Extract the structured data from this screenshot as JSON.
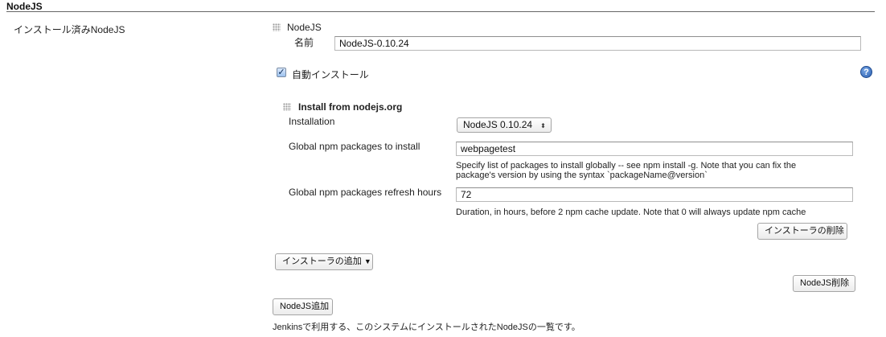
{
  "section": {
    "title": "NodeJS",
    "installations_label": "インストール済みNodeJS"
  },
  "installation": {
    "header": "NodeJS",
    "name_label": "名前",
    "name_value": "NodeJS-0.10.24",
    "auto_install_label": "自動インストール",
    "auto_install_checked": true,
    "help_icon": "help-icon"
  },
  "installer": {
    "header": "Install from nodejs.org",
    "installation_label": "Installation",
    "installation_value": "NodeJS 0.10.24",
    "npm_packages_label": "Global npm packages to install",
    "npm_packages_value": "webpagetest",
    "npm_packages_desc_line1": "Specify list of packages to install globally -- see npm install -g. Note that you can fix the",
    "npm_packages_desc_line2": "package's version by using the syntax `packageName@version`",
    "refresh_label": "Global npm packages refresh hours",
    "refresh_value": "72",
    "refresh_desc": "Duration, in hours, before 2 npm cache update. Note that 0 will always update npm cache",
    "delete_installer_label": "インストーラの削除"
  },
  "buttons": {
    "add_installer_label": "インストーラの追加",
    "add_installer_arrow": "▼",
    "delete_nodejs_label": "NodeJS削除",
    "add_nodejs_label": "NodeJS追加",
    "select_arrows": "⬍"
  },
  "footer": {
    "description": "Jenkinsで利用する、このシステムにインストールされたNodeJSの一覧です。"
  }
}
